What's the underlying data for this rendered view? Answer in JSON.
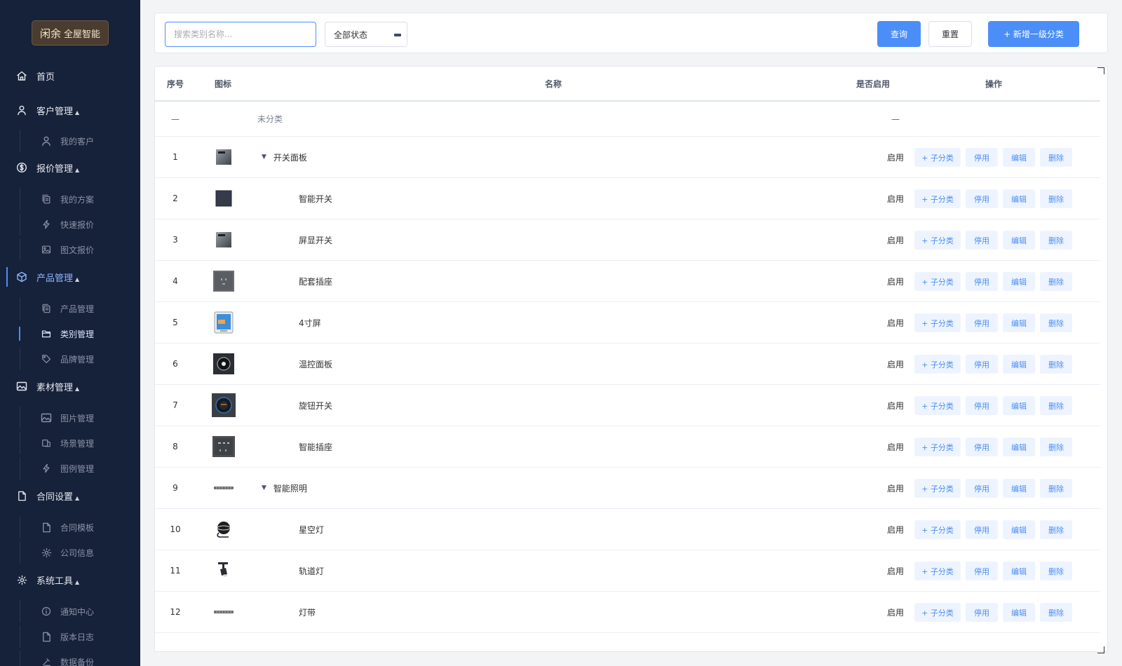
{
  "sidebar": {
    "logo": {
      "mark": "闲余",
      "text": "全屋智能"
    },
    "menu": [
      {
        "label": "首页",
        "icon": "home-icon",
        "caret": ""
      },
      {
        "label": "客户管理",
        "icon": "user-icon",
        "caret": "▲"
      },
      {
        "label": "我的客户",
        "icon": "user-icon"
      },
      {
        "label": "报价管理",
        "icon": "dollar-icon",
        "caret": "▲"
      },
      {
        "label": "我的方案",
        "icon": "copy-icon"
      },
      {
        "label": "快速报价",
        "icon": "lightning-icon"
      },
      {
        "label": "图文报价",
        "icon": "picture-icon"
      },
      {
        "label": "产品管理",
        "icon": "box-icon",
        "caret": "▲"
      },
      {
        "label": "产品管理",
        "icon": "copy-icon"
      },
      {
        "label": "类别管理",
        "icon": "folder-icon"
      },
      {
        "label": "品牌管理",
        "icon": "tag-icon"
      },
      {
        "label": "素材管理",
        "icon": "image-icon",
        "caret": "▲"
      },
      {
        "label": "图片管理",
        "icon": "image-icon"
      },
      {
        "label": "场景管理",
        "icon": "scene-icon"
      },
      {
        "label": "图例管理",
        "icon": "lightning-icon"
      },
      {
        "label": "合同设置",
        "icon": "document-icon",
        "caret": "▲"
      },
      {
        "label": "合同模板",
        "icon": "document-icon"
      },
      {
        "label": "公司信息",
        "icon": "gear-icon"
      },
      {
        "label": "系统工具",
        "icon": "gear-icon",
        "caret": "▲"
      },
      {
        "label": "通知中心",
        "icon": "info-icon"
      },
      {
        "label": "版本日志",
        "icon": "document-icon"
      },
      {
        "label": "数据备份",
        "icon": "backup-icon"
      }
    ]
  },
  "toolbar": {
    "search_placeholder": "搜索类别名称...",
    "status_value": "全部状态",
    "query_label": "查询",
    "reset_label": "重置",
    "add_label": "+ 新增一级分类"
  },
  "table": {
    "headers": {
      "index": "序号",
      "icon": "图标",
      "name": "名称",
      "enabled": "是否启用",
      "actions": "操作"
    },
    "uncategorized": {
      "index": "—",
      "name": "未分类",
      "enabled": "—"
    },
    "actions": {
      "add_child": "+ 子分类",
      "disable": "停用",
      "edit": "编辑",
      "delete": "删除"
    },
    "toggle_glyph": "▼",
    "rows": [
      {
        "index": "1",
        "name": "开关面板",
        "enabled": "启用",
        "level": 1,
        "thumb": "panel-silver"
      },
      {
        "index": "2",
        "name": "智能开关",
        "enabled": "启用",
        "level": 2,
        "thumb": "panel-dark"
      },
      {
        "index": "3",
        "name": "屏显开关",
        "enabled": "启用",
        "level": 2,
        "thumb": "panel-silver"
      },
      {
        "index": "4",
        "name": "配套插座",
        "enabled": "启用",
        "level": 2,
        "thumb": "socket"
      },
      {
        "index": "5",
        "name": "4寸屏",
        "enabled": "启用",
        "level": 2,
        "thumb": "screen"
      },
      {
        "index": "6",
        "name": "温控面板",
        "enabled": "启用",
        "level": 2,
        "thumb": "thermostat"
      },
      {
        "index": "7",
        "name": "旋钮开关",
        "enabled": "启用",
        "level": 2,
        "thumb": "knob"
      },
      {
        "index": "8",
        "name": "智能插座",
        "enabled": "启用",
        "level": 2,
        "thumb": "smart-socket"
      },
      {
        "index": "9",
        "name": "智能照明",
        "enabled": "启用",
        "level": 1,
        "thumb": "strip"
      },
      {
        "index": "10",
        "name": "星空灯",
        "enabled": "启用",
        "level": 2,
        "thumb": "star-lamp"
      },
      {
        "index": "11",
        "name": "轨道灯",
        "enabled": "启用",
        "level": 2,
        "thumb": "track-lamp"
      },
      {
        "index": "12",
        "name": "灯带",
        "enabled": "启用",
        "level": 2,
        "thumb": "strip"
      }
    ]
  }
}
